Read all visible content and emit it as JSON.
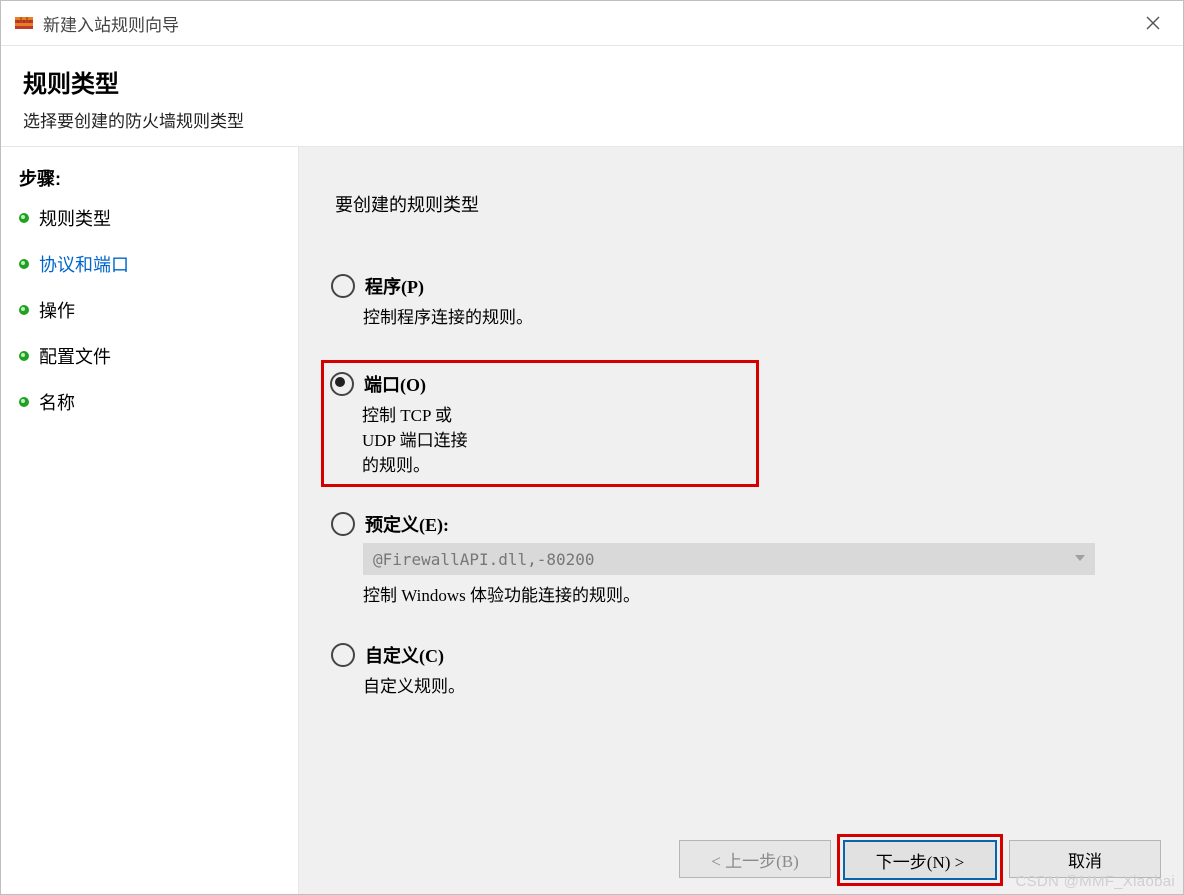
{
  "window": {
    "title": "新建入站规则向导"
  },
  "header": {
    "title": "规则类型",
    "subtitle": "选择要创建的防火墙规则类型"
  },
  "steps": {
    "title": "步骤:",
    "items": [
      {
        "label": "规则类型"
      },
      {
        "label": "协议和端口"
      },
      {
        "label": "操作"
      },
      {
        "label": "配置文件"
      },
      {
        "label": "名称"
      }
    ],
    "active_index": 1
  },
  "main": {
    "question": "要创建的规则类型",
    "options": [
      {
        "key": "program",
        "label": "程序(P)",
        "desc": "控制程序连接的规则。",
        "checked": false
      },
      {
        "key": "port",
        "label": "端口(O)",
        "desc": "控制 TCP 或 UDP 端口连接的规则。",
        "checked": true,
        "highlight": true
      },
      {
        "key": "predef",
        "label": "预定义(E):",
        "desc": "控制 Windows 体验功能连接的规则。",
        "checked": false,
        "combo": "@FirewallAPI.dll,-80200"
      },
      {
        "key": "custom",
        "label": "自定义(C)",
        "desc": "自定义规则。",
        "checked": false
      }
    ]
  },
  "footer": {
    "back": "< 上一步(B)",
    "next": "下一步(N) >",
    "cancel": "取消"
  },
  "watermark": "CSDN @MMF_Xiaobai"
}
